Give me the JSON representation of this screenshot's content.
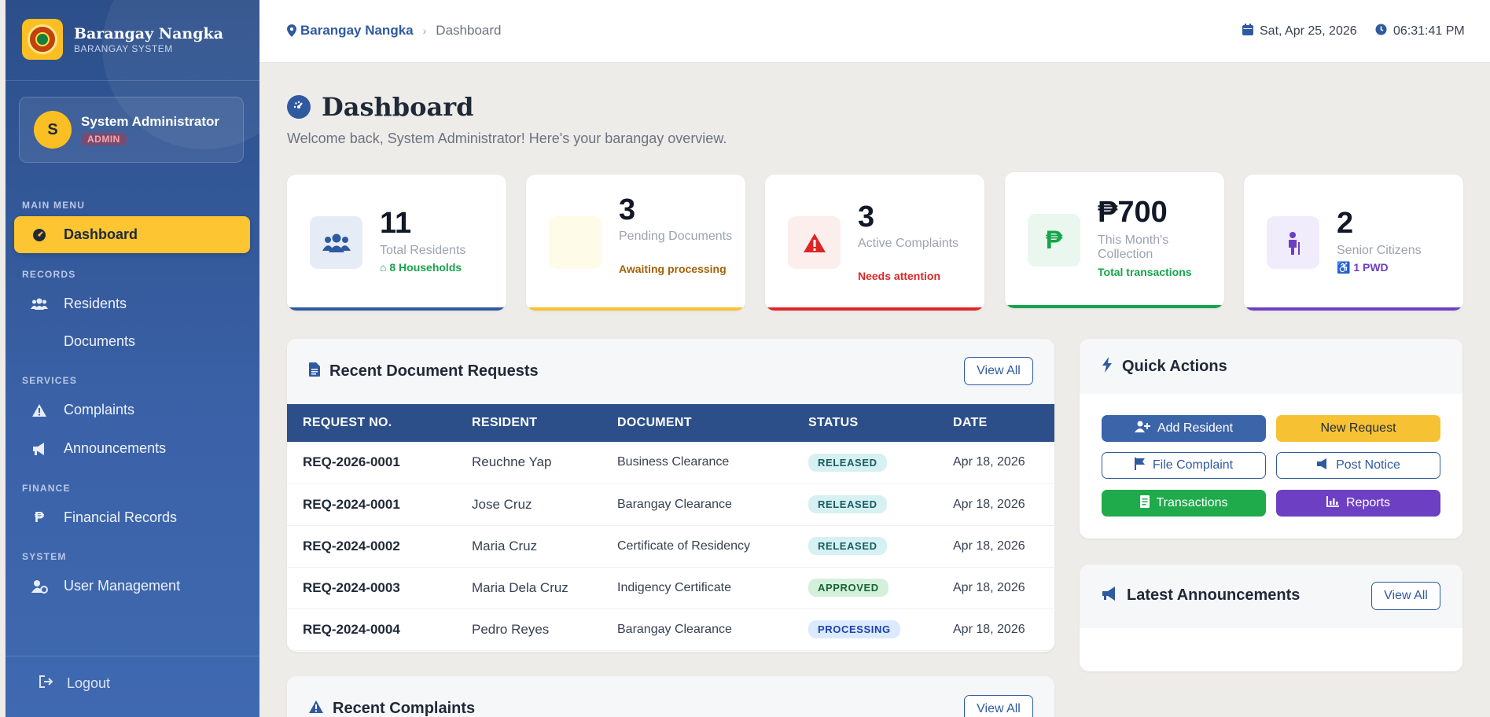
{
  "brand": {
    "name": "Barangay Nangka",
    "subtitle": "BARANGAY SYSTEM"
  },
  "user": {
    "initial": "S",
    "name": "System Administrator",
    "role": "ADMIN"
  },
  "sidebar": {
    "sections": [
      "MAIN MENU",
      "RECORDS",
      "SERVICES",
      "FINANCE",
      "SYSTEM"
    ],
    "items": [
      {
        "label": "Dashboard",
        "icon": "tachometer-icon"
      },
      {
        "label": "Residents",
        "icon": "users-icon"
      },
      {
        "label": "Documents",
        "icon": "none"
      },
      {
        "label": "Complaints",
        "icon": "warning-icon"
      },
      {
        "label": "Announcements",
        "icon": "megaphone-icon"
      },
      {
        "label": "Financial Records",
        "icon": "peso-icon"
      },
      {
        "label": "User Management",
        "icon": "user-cog-icon"
      }
    ],
    "logout": "Logout"
  },
  "topbar": {
    "breadcrumb_home": "Barangay Nangka",
    "breadcrumb_current": "Dashboard",
    "date": "Sat, Apr 25, 2026",
    "time": "06:31:41 PM"
  },
  "page": {
    "title": "Dashboard",
    "welcome": "Welcome back, System Administrator! Here's your barangay overview."
  },
  "stats": [
    {
      "value": "11",
      "label": "Total Residents",
      "sub": "8 Households",
      "color": "#2f5aa0",
      "icon": "users-icon"
    },
    {
      "value": "3",
      "label": "Pending Documents",
      "sub": "Awaiting processing",
      "color": "#f6c233",
      "icon": "file-icon"
    },
    {
      "value": "3",
      "label": "Active Complaints",
      "sub": "Needs attention",
      "color": "#dc2626",
      "icon": "warning-icon"
    },
    {
      "value": "₱700",
      "label": "This Month's Collection",
      "sub": "Total transactions",
      "color": "#16a34a",
      "icon": "peso-icon"
    },
    {
      "value": "2",
      "label": "Senior Citizens",
      "sub": "1 PWD",
      "color": "#6d3fc2",
      "icon": "senior-icon"
    }
  ],
  "recent_requests": {
    "title": "Recent Document Requests",
    "view_all": "View All",
    "columns": [
      "REQUEST NO.",
      "RESIDENT",
      "DOCUMENT",
      "STATUS",
      "DATE"
    ],
    "rows": [
      {
        "req": "REQ-2026-0001",
        "resident": "Reuchne Yap",
        "document": "Business Clearance",
        "status": "RELEASED",
        "date": "Apr 18, 2026"
      },
      {
        "req": "REQ-2024-0001",
        "resident": "Jose Cruz",
        "document": "Barangay Clearance",
        "status": "RELEASED",
        "date": "Apr 18, 2026"
      },
      {
        "req": "REQ-2024-0002",
        "resident": "Maria Cruz",
        "document": "Certificate of Residency",
        "status": "RELEASED",
        "date": "Apr 18, 2026"
      },
      {
        "req": "REQ-2024-0003",
        "resident": "Maria Dela Cruz",
        "document": "Indigency Certificate",
        "status": "APPROVED",
        "date": "Apr 18, 2026"
      },
      {
        "req": "REQ-2024-0004",
        "resident": "Pedro Reyes",
        "document": "Barangay Clearance",
        "status": "PROCESSING",
        "date": "Apr 18, 2026"
      }
    ]
  },
  "recent_complaints": {
    "title": "Recent Complaints",
    "view_all": "View All"
  },
  "quick_actions": {
    "title": "Quick Actions",
    "buttons": [
      {
        "label": "Add Resident",
        "icon": "user-plus-icon"
      },
      {
        "label": "New Request",
        "icon": "none"
      },
      {
        "label": "File Complaint",
        "icon": "flag-icon"
      },
      {
        "label": "Post Notice",
        "icon": "megaphone-icon"
      },
      {
        "label": "Transactions",
        "icon": "receipt-icon"
      },
      {
        "label": "Reports",
        "icon": "chart-icon"
      }
    ]
  },
  "announcements": {
    "title": "Latest Announcements",
    "view_all": "View All"
  }
}
